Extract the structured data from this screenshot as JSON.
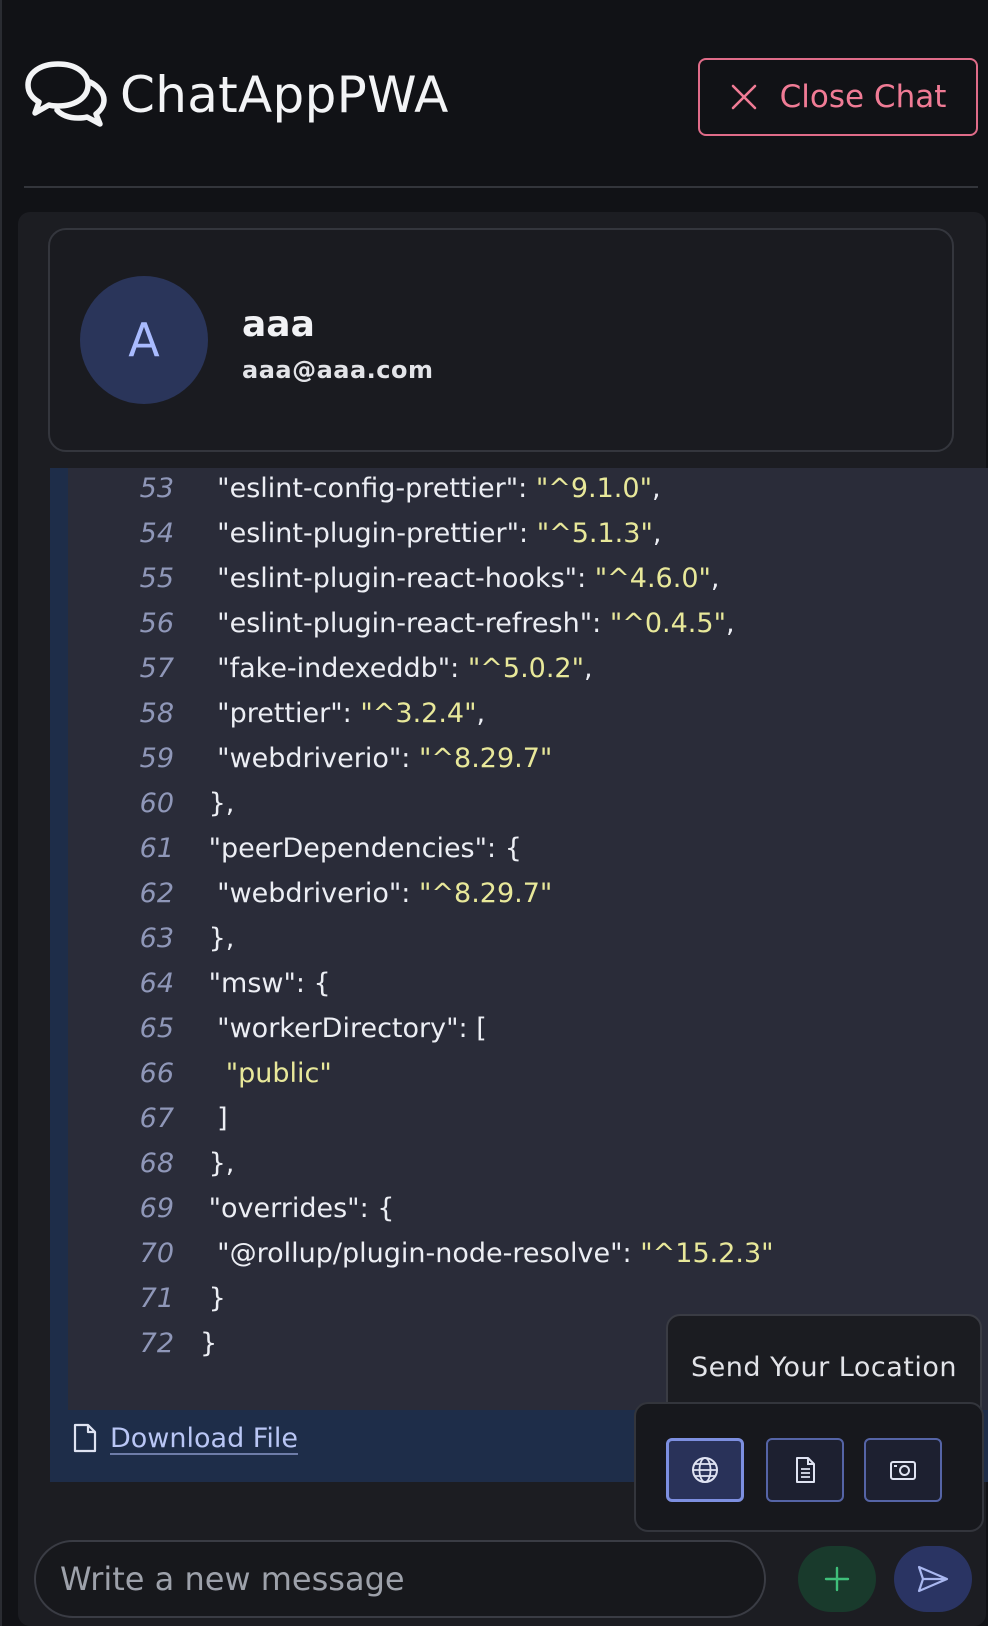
{
  "header": {
    "app_title": "ChatAppPWA",
    "close_label": "Close Chat"
  },
  "contact": {
    "initial": "A",
    "name": "aaa",
    "email": "aaa@aaa.com"
  },
  "code_lines": [
    {
      "n": "53",
      "indent": "  ",
      "key": "\"eslint-config-prettier\": ",
      "str": "\"^9.1.0\"",
      "tail": ","
    },
    {
      "n": "54",
      "indent": "  ",
      "key": "\"eslint-plugin-prettier\": ",
      "str": "\"^5.1.3\"",
      "tail": ","
    },
    {
      "n": "55",
      "indent": "  ",
      "key": "\"eslint-plugin-react-hooks\": ",
      "str": "\"^4.6.0\"",
      "tail": ","
    },
    {
      "n": "56",
      "indent": "  ",
      "key": "\"eslint-plugin-react-refresh\": ",
      "str": "\"^0.4.5\"",
      "tail": ","
    },
    {
      "n": "57",
      "indent": "  ",
      "key": "\"fake-indexeddb\": ",
      "str": "\"^5.0.2\"",
      "tail": ","
    },
    {
      "n": "58",
      "indent": "  ",
      "key": "\"prettier\": ",
      "str": "\"^3.2.4\"",
      "tail": ","
    },
    {
      "n": "59",
      "indent": "  ",
      "key": "\"webdriverio\": ",
      "str": "\"^8.29.7\"",
      "tail": ""
    },
    {
      "n": "60",
      "indent": " ",
      "key": "},",
      "str": "",
      "tail": ""
    },
    {
      "n": "61",
      "indent": " ",
      "key": "\"peerDependencies\": {",
      "str": "",
      "tail": ""
    },
    {
      "n": "62",
      "indent": "  ",
      "key": "\"webdriverio\": ",
      "str": "\"^8.29.7\"",
      "tail": ""
    },
    {
      "n": "63",
      "indent": " ",
      "key": "},",
      "str": "",
      "tail": ""
    },
    {
      "n": "64",
      "indent": " ",
      "key": "\"msw\": {",
      "str": "",
      "tail": ""
    },
    {
      "n": "65",
      "indent": "  ",
      "key": "\"workerDirectory\": [",
      "str": "",
      "tail": ""
    },
    {
      "n": "66",
      "indent": "   ",
      "key": "",
      "str": "\"public\"",
      "tail": ""
    },
    {
      "n": "67",
      "indent": "  ",
      "key": "]",
      "str": "",
      "tail": ""
    },
    {
      "n": "68",
      "indent": " ",
      "key": "},",
      "str": "",
      "tail": ""
    },
    {
      "n": "69",
      "indent": " ",
      "key": "\"overrides\": {",
      "str": "",
      "tail": ""
    },
    {
      "n": "70",
      "indent": "  ",
      "key": "\"@rollup/plugin-node-resolve\": ",
      "str": "\"^15.2.3\"",
      "tail": ""
    },
    {
      "n": "71",
      "indent": " ",
      "key": "}",
      "str": "",
      "tail": ""
    },
    {
      "n": "72",
      "indent": "",
      "key": "}",
      "str": "",
      "tail": ""
    }
  ],
  "message": {
    "download_label": "Download File"
  },
  "attach_menu": {
    "location_label": "Send Your Location"
  },
  "composer": {
    "placeholder": "Write a new message"
  },
  "colors": {
    "accent_close": "#e06c89",
    "string_color": "#e8e89a",
    "code_bg": "#2a2c39",
    "message_bg": "#1e2d49",
    "plus_bg": "#193a2c",
    "send_bg": "#2a3463"
  }
}
